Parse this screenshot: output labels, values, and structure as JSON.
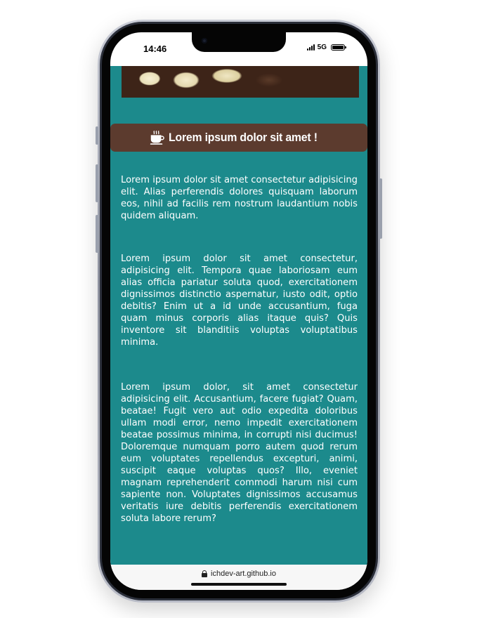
{
  "status_bar": {
    "time": "14:46",
    "network": "5G",
    "icons": [
      "signal-icon",
      "battery-icon"
    ]
  },
  "page": {
    "hero_image": "white-and-dark-chocolate-pieces",
    "title_icon": "coffee-cup-icon",
    "title": "Lorem ipsum dolor sit amet !",
    "paragraphs": [
      "Lorem ipsum dolor sit amet consectetur adipisicing elit. Alias perferendis dolores quisquam laborum eos, nihil ad facilis rem nostrum laudantium nobis quidem aliquam.",
      "Lorem ipsum dolor sit amet consectetur, adipisicing elit. Tempora quae laboriosam eum alias officia pariatur soluta quod, exercitationem dignissimos distinctio aspernatur, iusto odit, optio debitis? Enim ut a id unde accusantium, fuga quam minus corporis alias itaque quis? Quis inventore sit blanditiis voluptas voluptatibus minima.",
      "Lorem ipsum dolor, sit amet consectetur adipisicing elit. Accusantium, facere fugiat? Quam, beatae! Fugit vero aut odio expedita doloribus ullam modi error, nemo impedit exercitationem beatae possimus minima, in corrupti nisi ducimus! Doloremque numquam porro autem quod rerum eum voluptates repellendus excepturi, animi, suscipit eaque voluptas quos? Illo, eveniet magnam reprehenderit commodi harum nisi cum sapiente non. Voluptates dignissimos accusamus veritatis iure debitis perferendis exercitationem soluta labore rerum?"
    ]
  },
  "browser": {
    "url": "ichdev-art.github.io",
    "lock_icon": "lock-icon"
  },
  "colors": {
    "page_background": "#1c8a8c",
    "title_banner": "#5c3b2e",
    "text": "#ffffff"
  }
}
